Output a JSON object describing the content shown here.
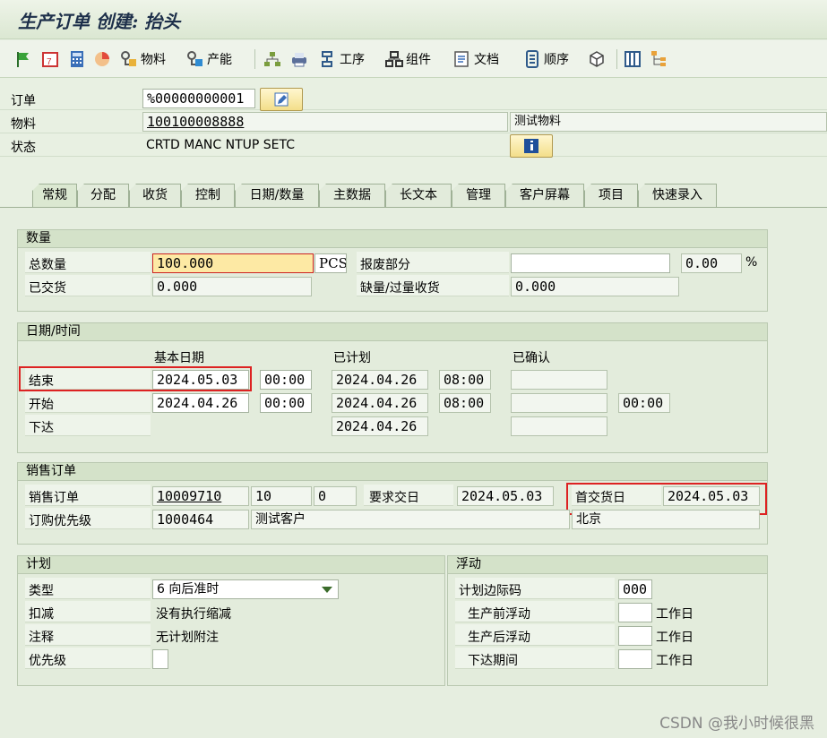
{
  "window": {
    "title": "生产订单 创建: 抬头"
  },
  "toolbar": {
    "material_label": "物料",
    "capacity_label": "产能",
    "operation_label": "工序",
    "component_label": "组件",
    "document_label": "文档",
    "sequence_label": "顺序"
  },
  "header": {
    "order_label": "订单",
    "order_value": "%00000000001",
    "material_label": "物料",
    "material_value": "100100008888",
    "material_desc": "测试物料",
    "status_label": "状态",
    "status_value": "CRTD MANC NTUP SETC"
  },
  "tabs": [
    "常规",
    "分配",
    "收货",
    "控制",
    "日期/数量",
    "主数据",
    "长文本",
    "管理",
    "客户屏幕",
    "项目",
    "快速录入"
  ],
  "quantity": {
    "title": "数量",
    "total_label": "总数量",
    "total_value": "100.000",
    "unit": "PCS",
    "scrap_label": "报废部分",
    "scrap_value": "",
    "scrap_pct": "0.00",
    "pct_sign": "%",
    "delivered_label": "已交货",
    "delivered_value": "0.000",
    "shortage_label": "缺量/过量收货",
    "shortage_value": "0.000"
  },
  "dates": {
    "title": "日期/时间",
    "col_basic": "基本日期",
    "col_scheduled": "已计划",
    "col_confirmed": "已确认",
    "end_label": "结束",
    "end_basic_date": "2024.05.03",
    "end_basic_time": "00:00",
    "end_sched_date": "2024.04.26",
    "end_sched_time": "08:00",
    "start_label": "开始",
    "start_basic_date": "2024.04.26",
    "start_basic_time": "00:00",
    "start_sched_date": "2024.04.26",
    "start_sched_time": "08:00",
    "start_conf_time": "00:00",
    "release_label": "下达",
    "release_sched_date": "2024.04.26"
  },
  "sales": {
    "title": "销售订单",
    "so_label": "销售订单",
    "so_value": "10009710",
    "item_value": "10",
    "sched_value": "0",
    "req_label": "要求交日",
    "req_value": "2024.05.03",
    "first_label": "首交货日",
    "first_value": "2024.05.03",
    "sold_to_label": "订购优先级",
    "sold_to_value": "1000464",
    "customer_name": "测试客户",
    "city": "北京"
  },
  "plan": {
    "title": "计划",
    "type_label": "类型",
    "type_value": "6 向后准时",
    "reduction_label": "扣减",
    "reduction_value": "没有执行缩减",
    "note_label": "注释",
    "note_value": "无计划附注",
    "priority_label": "优先级"
  },
  "float": {
    "title": "浮动",
    "key_label": "计划边际码",
    "key_value": "000",
    "before_label": "生产前浮动",
    "after_label": "生产后浮动",
    "release_label": "下达期间",
    "unit": "工作日"
  },
  "watermark": "CSDN @我小时候很黑"
}
